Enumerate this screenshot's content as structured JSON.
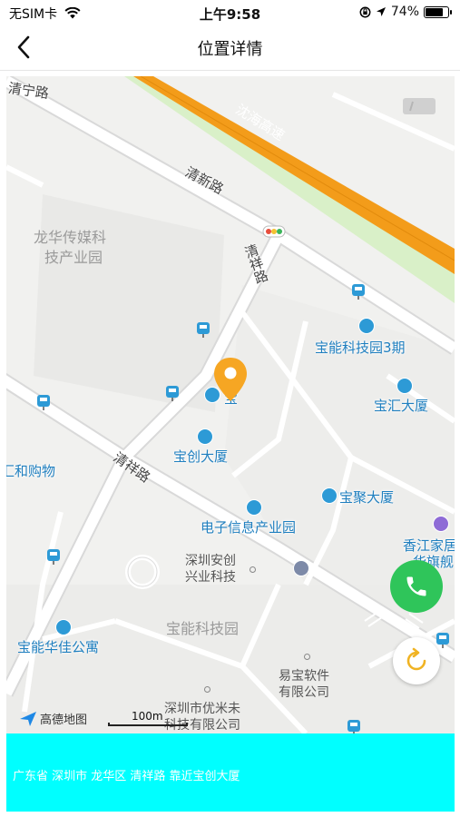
{
  "status_bar": {
    "carrier": "无SIM卡",
    "time": "上午9:58",
    "battery": "74%",
    "battery_level": 0.74,
    "icons": [
      "wifi-icon",
      "orientation-lock-icon",
      "location-arrow-icon",
      "battery-icon"
    ]
  },
  "nav": {
    "title": "位置详情",
    "back_icon": "chevron-left-icon"
  },
  "map": {
    "roads": {
      "qingning": "清宁路",
      "shenhai": "沈海高速",
      "qingxin": "清新路",
      "qingxiang_upper": "清祥路",
      "qingxiang_lower": "清祥路"
    },
    "areas": {
      "media_park_line1": "龙华传媒科",
      "media_park_line2": "技产业园",
      "baoneng_park": "宝能科技园"
    },
    "pois": {
      "baoneng_phase3": "宝能科技园3期",
      "baohui": "宝汇大厦",
      "marker_partial": "宝",
      "baochuang": "宝创大厦",
      "shopping": "汇和购物",
      "baoju": "宝聚大厦",
      "electronics_park": "电子信息产业园",
      "xiangjiang_line1": "香江家居",
      "xiangjiang_line2": "华旗舰",
      "baoneng_huajia": "宝能华佳公寓",
      "anchuang_line1": "深圳安创",
      "anchuang_line2": "兴业科技",
      "yibao_line1": "易宝软件",
      "yibao_line2": "有限公司",
      "youmi_line1": "深圳市优米未",
      "youmi_line2": "科技有限公司"
    },
    "logo": "高德地图",
    "scale": "100m"
  },
  "actions": {
    "call_icon": "phone-icon",
    "locate_icon": "refresh-location-icon"
  },
  "address": "广东省 深圳市 龙华区 清祥路 靠近宝创大厦",
  "colors": {
    "highway": "#f39c1a",
    "highway_green": "#c9ecb5",
    "marker": "#f6a623",
    "poi_text": "#1f7fbf",
    "call_green": "#2fc55a",
    "address_bg": "#00ffff"
  }
}
